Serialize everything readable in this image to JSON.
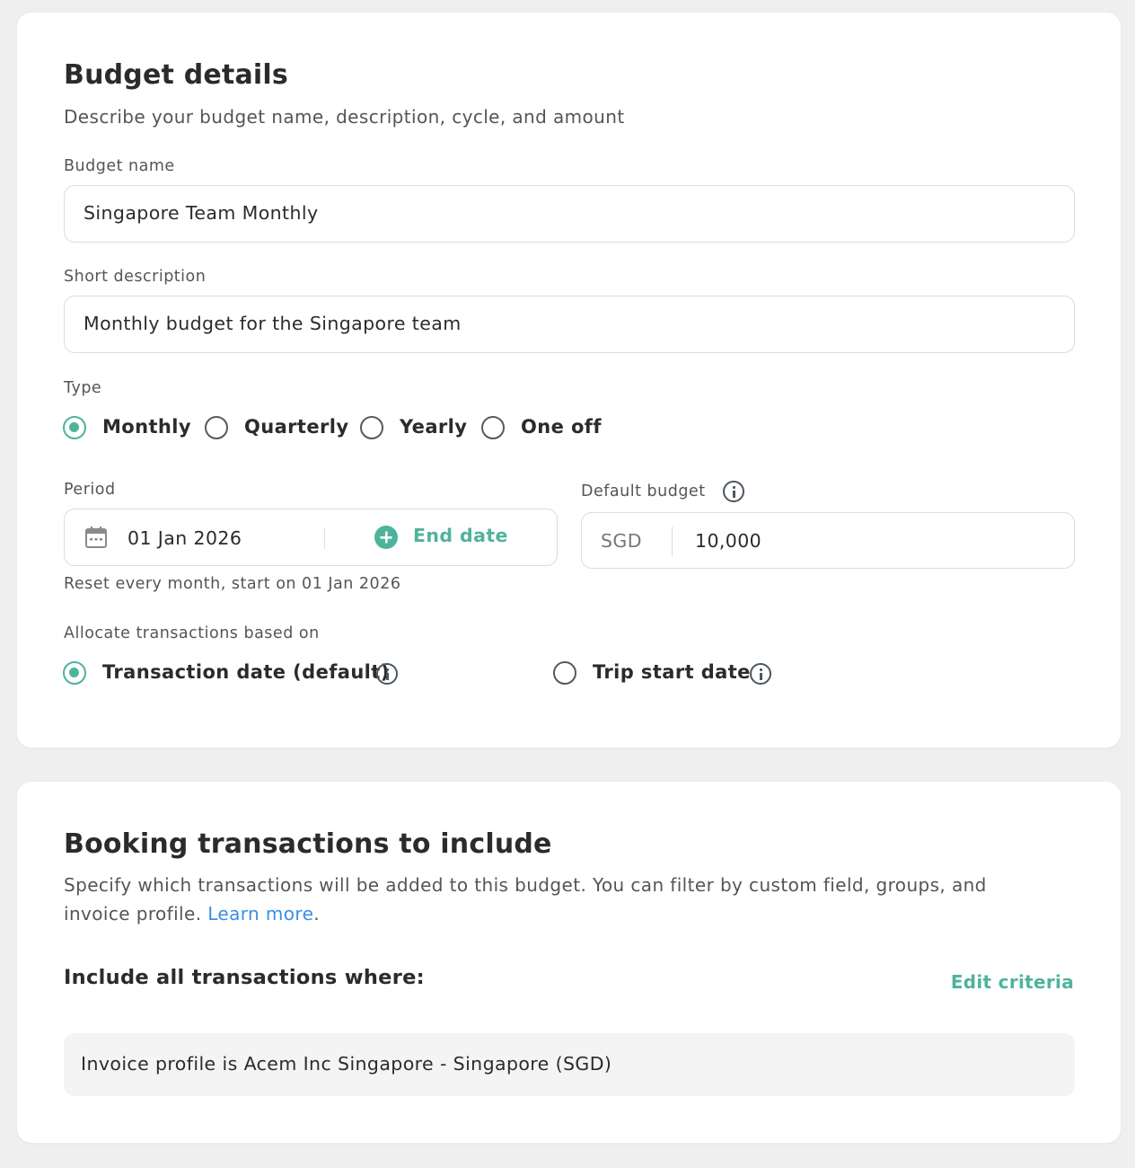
{
  "budget_details": {
    "title": "Budget details",
    "subtitle": "Describe your budget name, description, cycle, and amount",
    "name_label": "Budget name",
    "name_value": "Singapore Team Monthly",
    "description_label": "Short description",
    "description_value": "Monthly budget for the Singapore team",
    "type_label": "Type",
    "type_options": [
      "Monthly",
      "Quarterly",
      "Yearly",
      "One off"
    ],
    "type_selected": "Monthly",
    "period_label": "Period",
    "start_date": "01 Jan 2026",
    "end_date_label": "End date",
    "period_hint": "Reset every month, start on 01 Jan 2026",
    "default_budget_label": "Default budget",
    "currency": "SGD",
    "amount": "10,000",
    "allocate_label": "Allocate transactions based on",
    "allocate_options": [
      "Transaction date (default)",
      "Trip start date"
    ],
    "allocate_selected": "Transaction date (default)"
  },
  "booking": {
    "title": "Booking transactions to include",
    "description_line1": "Specify which transactions will be added to this budget. You can filter by custom field, groups, and",
    "description_line2_prefix": "invoice profile.",
    "learn_more": "Learn more",
    "description_line2_suffix": ".",
    "criteria_heading": "Include all transactions where:",
    "edit_criteria": "Edit criteria",
    "criteria_text": "Invoice profile is Acem Inc Singapore - Singapore (SGD)"
  },
  "colors": {
    "accent": "#4fb39c",
    "link": "#3a8ee6",
    "page_bg": "#efefef"
  },
  "icons": {
    "calendar": "calendar-icon",
    "add": "plus-circle-icon",
    "info": "info-icon"
  }
}
